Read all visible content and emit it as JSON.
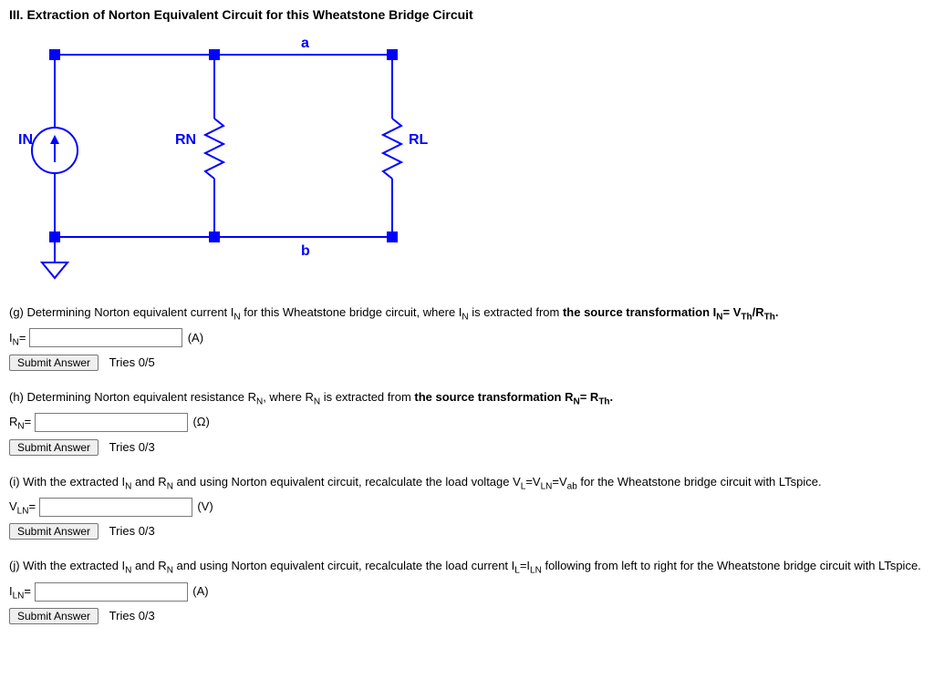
{
  "title": "III. Extraction of Norton Equivalent Circuit for this Wheatstone Bridge Circuit",
  "circuit": {
    "labels": {
      "a": "a",
      "b": "b",
      "IN": "IN",
      "RN": "RN",
      "RL": "RL"
    }
  },
  "q_g": {
    "prompt_pre": "(g) Determining Norton equivalent current I",
    "sub1": "N",
    "prompt_mid": " for this Wheatstone bridge circuit, where I",
    "sub2": "N",
    "prompt_post": " is extracted from ",
    "bold": "the source transformation I",
    "bold_sub": "N",
    "bold_eq": "= V",
    "bold_sub2": "Th",
    "bold_slash": "/R",
    "bold_sub3": "Th",
    "bold_end": ".",
    "var_pre": "I",
    "var_sub": "N",
    "var_eq": "=",
    "unit": "(A)",
    "submit": "Submit Answer",
    "tries": "Tries 0/5"
  },
  "q_h": {
    "prompt_pre": "(h) Determining Norton equivalent resistance R",
    "sub1": "N",
    "prompt_mid": ", where R",
    "sub2": "N",
    "prompt_post": " is extracted from ",
    "bold": "the source transformation R",
    "bold_sub": "N",
    "bold_eq": "= R",
    "bold_sub2": "Th",
    "bold_end": ".",
    "var_pre": "R",
    "var_sub": "N",
    "var_eq": "=",
    "unit": "(Ω)",
    "submit": "Submit Answer",
    "tries": "Tries 0/3"
  },
  "q_i": {
    "prompt_pre": "(i) With the extracted I",
    "sub1": "N",
    "prompt_mid1": " and R",
    "sub2": "N",
    "prompt_mid2": " and using Norton equivalent circuit, recalculate the load voltage V",
    "sub3": "L",
    "prompt_eq1": "=V",
    "sub4": "LN",
    "prompt_eq2": "=V",
    "sub5": "ab",
    "prompt_post": " for the Wheatstone bridge circuit with LTspice.",
    "var_pre": "V",
    "var_sub": "LN",
    "var_eq": "=",
    "unit": "(V)",
    "submit": "Submit Answer",
    "tries": "Tries 0/3"
  },
  "q_j": {
    "prompt_pre": "(j) With the extracted I",
    "sub1": "N",
    "prompt_mid1": " and R",
    "sub2": "N",
    "prompt_mid2": " and using Norton equivalent circuit, recalculate the load current I",
    "sub3": "L",
    "prompt_eq1": "=I",
    "sub4": "LN",
    "prompt_post": " following from left to right for the Wheatstone bridge circuit with LTspice.",
    "var_pre": "I",
    "var_sub": "LN",
    "var_eq": "=",
    "unit": "(A)",
    "submit": "Submit Answer",
    "tries": "Tries 0/3"
  }
}
